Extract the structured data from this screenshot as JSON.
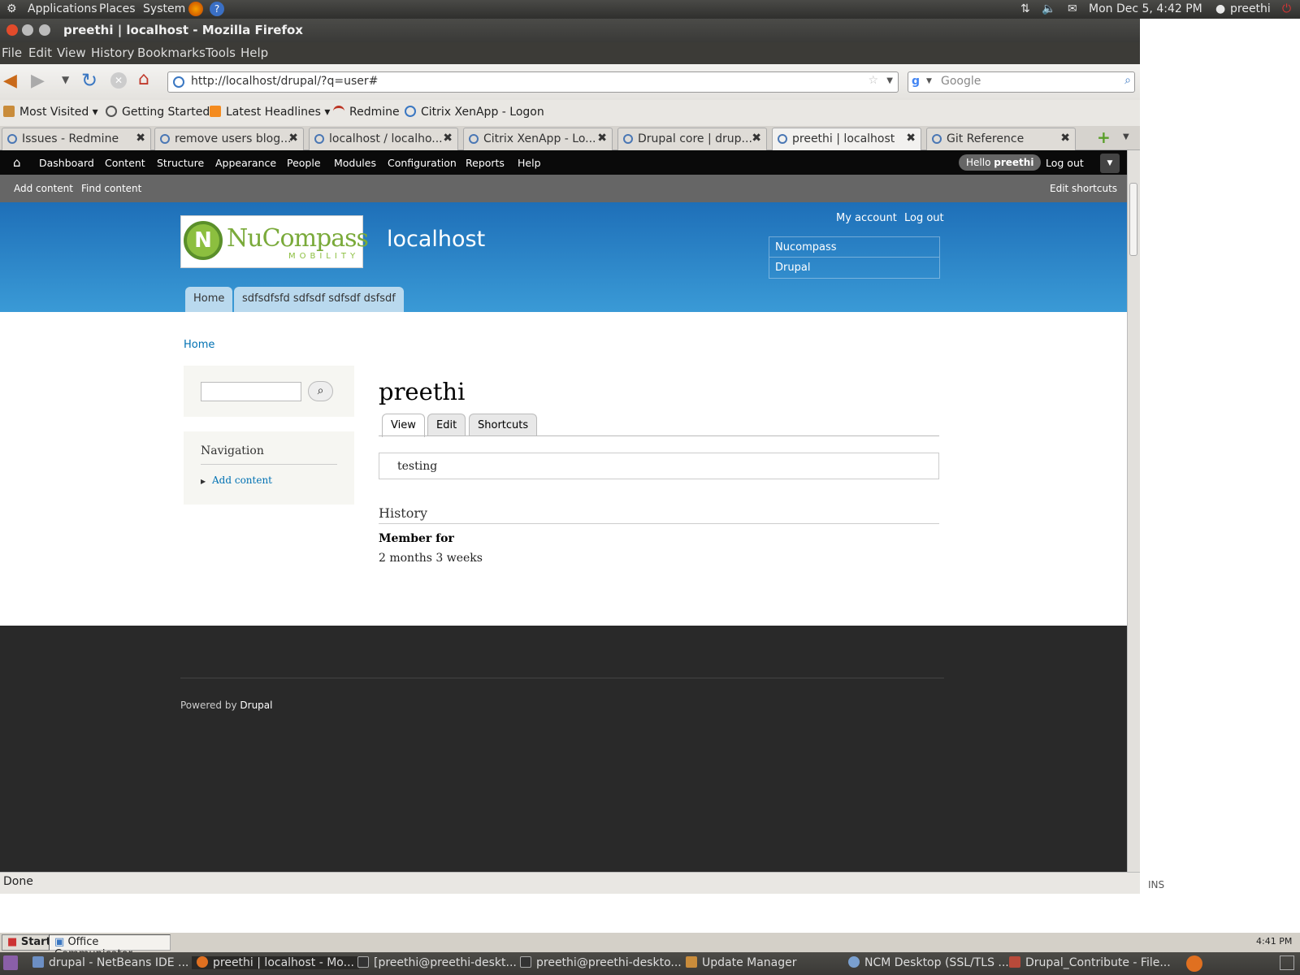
{
  "gnome_panel": {
    "applications": "Applications",
    "places": "Places",
    "system": "System",
    "clock": "Mon Dec  5,  4:42 PM",
    "user": "preethi"
  },
  "window": {
    "title": "preethi | localhost - Mozilla Firefox"
  },
  "menu": [
    "File",
    "Edit",
    "View",
    "History",
    "Bookmarks",
    "Tools",
    "Help"
  ],
  "navigation": {
    "url": "http://localhost/drupal/?q=user#",
    "search_placeholder": "Google"
  },
  "bookmarks": [
    "Most Visited ▾",
    "Getting Started",
    "Latest Headlines ▾",
    "Redmine",
    "Citrix XenApp - Logon"
  ],
  "tabs": [
    {
      "label": "Issues - Redmine",
      "active": false
    },
    {
      "label": "remove users blog...",
      "active": false
    },
    {
      "label": "localhost / localho...",
      "active": false
    },
    {
      "label": "Citrix XenApp - Lo...",
      "active": false
    },
    {
      "label": "Drupal core | drup...",
      "active": false
    },
    {
      "label": "preethi | localhost",
      "active": true
    },
    {
      "label": "Git Reference",
      "active": false
    }
  ],
  "drupal_toolbar": {
    "items": [
      "Dashboard",
      "Content",
      "Structure",
      "Appearance",
      "People",
      "Modules",
      "Configuration",
      "Reports",
      "Help"
    ],
    "hello": "Hello",
    "username": "preethi",
    "logout": "Log out"
  },
  "shortcuts": {
    "add_content": "Add content",
    "find_content": "Find content",
    "edit_shortcuts": "Edit shortcuts"
  },
  "header": {
    "logo_text": "NuCompass",
    "logo_sub": "MOBILITY",
    "site_name": "localhost",
    "my_account": "My account",
    "log_out": "Log out",
    "side_links": [
      "Nucompass",
      "Drupal"
    ],
    "main_menu": [
      "Home",
      "sdfsdfsfd sdfsdf sdfsdf dsfsdf"
    ]
  },
  "breadcrumb": "Home",
  "sidebar": {
    "search_value": "",
    "navigation_title": "Navigation",
    "nav_items": [
      "Add content"
    ]
  },
  "content": {
    "title": "preethi",
    "local_tabs": [
      "View",
      "Edit",
      "Shortcuts"
    ],
    "body_text": "testing",
    "history_title": "History",
    "member_for_label": "Member for",
    "member_for_value": "2 months 3 weeks"
  },
  "footer": {
    "powered_by": "Powered by",
    "drupal": "Drupal"
  },
  "status": {
    "text": "Done",
    "ins": "INS"
  },
  "windows_bar": {
    "start": "Start",
    "app": "Office Communicator",
    "time": "4:41 PM"
  },
  "taskbar": [
    "drupal - NetBeans IDE ...",
    "preethi | localhost - Mo...",
    "[preethi@preethi-deskt...",
    "preethi@preethi-deskto...",
    "Update Manager",
    "NCM Desktop (SSL/TLS ...",
    "Drupal_Contribute - File..."
  ]
}
